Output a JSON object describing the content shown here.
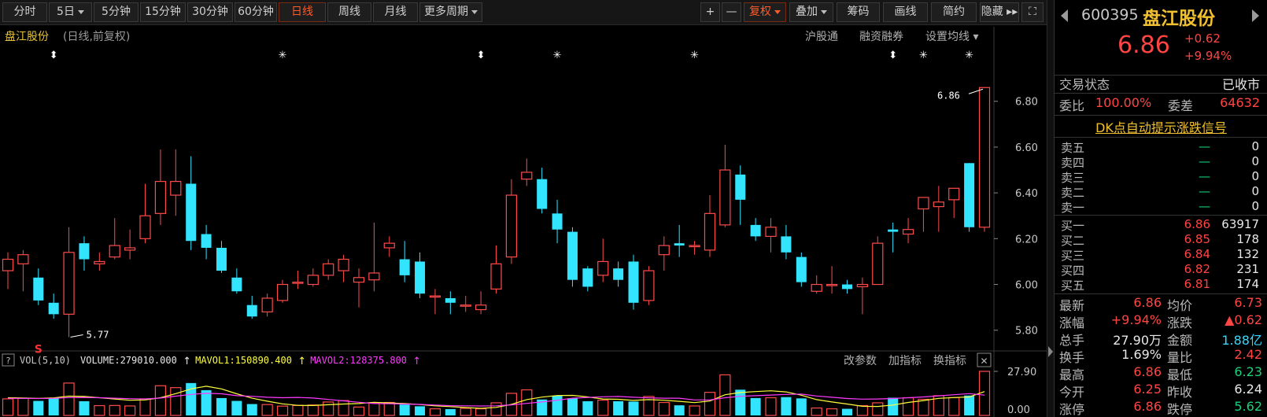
{
  "toolbar": {
    "periods": [
      {
        "label": "分时",
        "dropdown": false,
        "active": false
      },
      {
        "label": "5日",
        "dropdown": true,
        "active": false
      },
      {
        "label": "5分钟",
        "dropdown": false,
        "active": false
      },
      {
        "label": "15分钟",
        "dropdown": false,
        "active": false
      },
      {
        "label": "30分钟",
        "dropdown": false,
        "active": false
      },
      {
        "label": "60分钟",
        "dropdown": false,
        "active": false
      },
      {
        "label": "日线",
        "dropdown": false,
        "active": true
      },
      {
        "label": "周线",
        "dropdown": false,
        "active": false
      },
      {
        "label": "月线",
        "dropdown": false,
        "active": false
      },
      {
        "label": "更多周期",
        "dropdown": true,
        "active": false
      }
    ],
    "right": [
      {
        "label": "+",
        "dropdown": false,
        "active": false
      },
      {
        "label": "—",
        "dropdown": false,
        "active": false
      },
      {
        "label": "复权",
        "dropdown": true,
        "active": true
      },
      {
        "label": "叠加",
        "dropdown": true,
        "active": false
      },
      {
        "label": "筹码",
        "dropdown": false,
        "active": false
      },
      {
        "label": "画线",
        "dropdown": false,
        "active": false
      },
      {
        "label": "简约",
        "dropdown": false,
        "active": false
      },
      {
        "label": "隐藏 ▸▸",
        "dropdown": false,
        "active": false
      },
      {
        "label": "⛶",
        "dropdown": false,
        "active": false
      }
    ]
  },
  "header": {
    "stock_name": "盘江股份",
    "mode": "(日线,前复权)",
    "links": [
      "沪股通",
      "融资融券",
      "设置均线 ▾"
    ]
  },
  "chart_data": [
    {
      "type": "candlestick",
      "y_axis_ticks": [
        6.8,
        6.6,
        6.4,
        6.2,
        6.0,
        5.8
      ],
      "ylim": [
        5.72,
        6.94
      ],
      "annotations": {
        "high_label": "6.86",
        "low_label": "5.77",
        "signal": "S"
      },
      "event_markers": [
        {
          "candle": 3,
          "symbol": "⬍"
        },
        {
          "candle": 18,
          "symbol": "✳"
        },
        {
          "candle": 31,
          "symbol": "⬍"
        },
        {
          "candle": 36,
          "symbol": "✳"
        },
        {
          "candle": 45,
          "symbol": "✳"
        },
        {
          "candle": 58,
          "symbol": "⬍"
        },
        {
          "candle": 60,
          "symbol": "✳"
        },
        {
          "candle": 63,
          "symbol": "✳"
        }
      ],
      "candles": [
        {
          "o": 6.06,
          "c": 6.11,
          "h": 6.14,
          "l": 5.98
        },
        {
          "o": 6.09,
          "c": 6.13,
          "h": 6.15,
          "l": 5.97
        },
        {
          "o": 6.03,
          "c": 5.93,
          "h": 6.07,
          "l": 5.91
        },
        {
          "o": 5.92,
          "c": 5.87,
          "h": 5.96,
          "l": 5.85
        },
        {
          "o": 5.87,
          "c": 6.14,
          "h": 6.25,
          "l": 5.77
        },
        {
          "o": 6.18,
          "c": 6.11,
          "h": 6.21,
          "l": 6.06
        },
        {
          "o": 6.09,
          "c": 6.1,
          "h": 6.14,
          "l": 6.06
        },
        {
          "o": 6.12,
          "c": 6.17,
          "h": 6.29,
          "l": 6.11
        },
        {
          "o": 6.15,
          "c": 6.16,
          "h": 6.24,
          "l": 6.11
        },
        {
          "o": 6.2,
          "c": 6.3,
          "h": 6.44,
          "l": 6.18
        },
        {
          "o": 6.31,
          "c": 6.45,
          "h": 6.59,
          "l": 6.26
        },
        {
          "o": 6.39,
          "c": 6.45,
          "h": 6.59,
          "l": 6.3
        },
        {
          "o": 6.44,
          "c": 6.19,
          "h": 6.56,
          "l": 6.15
        },
        {
          "o": 6.22,
          "c": 6.16,
          "h": 6.26,
          "l": 6.11
        },
        {
          "o": 6.16,
          "c": 6.06,
          "h": 6.19,
          "l": 6.05
        },
        {
          "o": 6.03,
          "c": 5.97,
          "h": 6.07,
          "l": 5.96
        },
        {
          "o": 5.91,
          "c": 5.86,
          "h": 5.95,
          "l": 5.85
        },
        {
          "o": 5.88,
          "c": 5.94,
          "h": 5.96,
          "l": 5.86
        },
        {
          "o": 5.93,
          "c": 6.0,
          "h": 6.02,
          "l": 5.92
        },
        {
          "o": 6.01,
          "c": 6.01,
          "h": 6.06,
          "l": 5.98
        },
        {
          "o": 6.0,
          "c": 6.04,
          "h": 6.07,
          "l": 5.99
        },
        {
          "o": 6.04,
          "c": 6.09,
          "h": 6.11,
          "l": 6.02
        },
        {
          "o": 6.06,
          "c": 6.11,
          "h": 6.13,
          "l": 6.01
        },
        {
          "o": 6.01,
          "c": 6.03,
          "h": 6.07,
          "l": 5.9
        },
        {
          "o": 6.02,
          "c": 6.05,
          "h": 6.27,
          "l": 5.97
        },
        {
          "o": 6.16,
          "c": 6.18,
          "h": 6.21,
          "l": 6.12
        },
        {
          "o": 6.11,
          "c": 6.04,
          "h": 6.19,
          "l": 6.01
        },
        {
          "o": 6.1,
          "c": 5.96,
          "h": 6.14,
          "l": 5.94
        },
        {
          "o": 5.95,
          "c": 5.95,
          "h": 5.98,
          "l": 5.87
        },
        {
          "o": 5.94,
          "c": 5.92,
          "h": 5.97,
          "l": 5.87
        },
        {
          "o": 5.91,
          "c": 5.91,
          "h": 5.95,
          "l": 5.88
        },
        {
          "o": 5.89,
          "c": 5.91,
          "h": 5.97,
          "l": 5.87
        },
        {
          "o": 5.98,
          "c": 6.09,
          "h": 6.17,
          "l": 5.96
        },
        {
          "o": 6.12,
          "c": 6.39,
          "h": 6.46,
          "l": 6.09
        },
        {
          "o": 6.46,
          "c": 6.49,
          "h": 6.55,
          "l": 6.43
        },
        {
          "o": 6.46,
          "c": 6.33,
          "h": 6.51,
          "l": 6.31
        },
        {
          "o": 6.31,
          "c": 6.24,
          "h": 6.37,
          "l": 6.18
        },
        {
          "o": 6.23,
          "c": 6.02,
          "h": 6.25,
          "l": 5.99
        },
        {
          "o": 6.07,
          "c": 5.99,
          "h": 6.08,
          "l": 5.97
        },
        {
          "o": 6.04,
          "c": 6.1,
          "h": 6.2,
          "l": 6.01
        },
        {
          "o": 6.07,
          "c": 6.02,
          "h": 6.1,
          "l": 5.99
        },
        {
          "o": 6.1,
          "c": 5.92,
          "h": 6.13,
          "l": 5.89
        },
        {
          "o": 5.93,
          "c": 6.06,
          "h": 6.08,
          "l": 5.91
        },
        {
          "o": 6.13,
          "c": 6.17,
          "h": 6.21,
          "l": 6.06
        },
        {
          "o": 6.18,
          "c": 6.17,
          "h": 6.26,
          "l": 6.12
        },
        {
          "o": 6.17,
          "c": 6.17,
          "h": 6.19,
          "l": 6.13
        },
        {
          "o": 6.15,
          "c": 6.31,
          "h": 6.39,
          "l": 6.12
        },
        {
          "o": 6.26,
          "c": 6.5,
          "h": 6.61,
          "l": 6.25
        },
        {
          "o": 6.48,
          "c": 6.37,
          "h": 6.52,
          "l": 6.26
        },
        {
          "o": 6.26,
          "c": 6.21,
          "h": 6.29,
          "l": 6.19
        },
        {
          "o": 6.21,
          "c": 6.25,
          "h": 6.29,
          "l": 6.14
        },
        {
          "o": 6.21,
          "c": 6.14,
          "h": 6.26,
          "l": 6.11
        },
        {
          "o": 6.12,
          "c": 6.01,
          "h": 6.14,
          "l": 5.99
        },
        {
          "o": 5.97,
          "c": 6.0,
          "h": 6.04,
          "l": 5.96
        },
        {
          "o": 6.0,
          "c": 6.0,
          "h": 6.08,
          "l": 5.96
        },
        {
          "o": 6.0,
          "c": 5.98,
          "h": 6.02,
          "l": 5.96
        },
        {
          "o": 5.99,
          "c": 6.0,
          "h": 6.03,
          "l": 5.87
        },
        {
          "o": 6.0,
          "c": 6.18,
          "h": 6.21,
          "l": 6.0
        },
        {
          "o": 6.24,
          "c": 6.23,
          "h": 6.27,
          "l": 6.14
        },
        {
          "o": 6.22,
          "c": 6.24,
          "h": 6.29,
          "l": 6.18
        },
        {
          "o": 6.33,
          "c": 6.38,
          "h": 6.38,
          "l": 6.23
        },
        {
          "o": 6.34,
          "c": 6.36,
          "h": 6.43,
          "l": 6.23
        },
        {
          "o": 6.37,
          "c": 6.42,
          "h": 6.42,
          "l": 6.29
        },
        {
          "o": 6.53,
          "c": 6.25,
          "h": 6.53,
          "l": 6.23
        },
        {
          "o": 6.25,
          "c": 6.86,
          "h": 6.86,
          "l": 6.23
        }
      ]
    },
    {
      "type": "bar",
      "title": "VOL(5,10)",
      "legend": [
        {
          "label": "VOLUME:279010.000",
          "color": "#e8e8e8"
        },
        {
          "label": "MAVOL1:150890.400",
          "color": "#ffff3a"
        },
        {
          "label": "MAVOL2:128375.800",
          "color": "#ff3aff"
        }
      ],
      "y_axis_ticks": [
        "27.90",
        "0.00"
      ],
      "ylim": [
        0,
        279010
      ],
      "volumes": [
        105000,
        108000,
        92000,
        108000,
        205000,
        90000,
        62000,
        63000,
        60000,
        105000,
        188000,
        176000,
        205000,
        160000,
        110000,
        92000,
        72000,
        69000,
        59000,
        63000,
        66000,
        85000,
        94000,
        53000,
        80000,
        82000,
        69000,
        58000,
        42000,
        40000,
        45000,
        42000,
        80000,
        140000,
        162000,
        101000,
        125000,
        108000,
        90000,
        97000,
        90000,
        88000,
        120000,
        82000,
        64000,
        60000,
        146000,
        257000,
        163000,
        110000,
        112000,
        116000,
        108000,
        47000,
        42000,
        42000,
        62000,
        80000,
        112000,
        112000,
        102000,
        125000,
        113000,
        126000,
        279010
      ],
      "mavol1": [
        112000,
        110000,
        108000,
        111000,
        122000,
        120000,
        112000,
        104000,
        96000,
        98000,
        112000,
        138000,
        168000,
        185000,
        168000,
        137000,
        109000,
        90000,
        73000,
        64000,
        63000,
        68000,
        72000,
        75000,
        83000,
        79000,
        75000,
        69000,
        61000,
        56000,
        50000,
        45000,
        51000,
        70000,
        100000,
        116000,
        126000,
        127000,
        117000,
        104000,
        102000,
        95000,
        100000,
        96000,
        89000,
        81000,
        91000,
        131000,
        145000,
        151000,
        156000,
        149000,
        128000,
        100000,
        85000,
        72000,
        58000,
        57000,
        66000,
        82000,
        94000,
        108000,
        113000,
        117000,
        150890
      ],
      "mavol2": [
        108000,
        108000,
        107000,
        108000,
        113000,
        114000,
        112000,
        109000,
        106000,
        104000,
        110000,
        122000,
        133000,
        140000,
        137000,
        125000,
        121000,
        115000,
        112000,
        114000,
        110000,
        101000,
        92000,
        83000,
        75000,
        74000,
        72000,
        70000,
        66000,
        62000,
        61000,
        60000,
        61000,
        67000,
        76000,
        85000,
        96000,
        109000,
        114000,
        118000,
        120000,
        115000,
        111000,
        109000,
        109000,
        98000,
        98000,
        112000,
        121000,
        125000,
        129000,
        133000,
        135000,
        123000,
        115000,
        107000,
        103000,
        104000,
        107000,
        112000,
        117000,
        124000,
        131000,
        138000,
        128376
      ]
    }
  ],
  "vol_header": {
    "help": "?",
    "title": "VOL(5,10)",
    "tools": [
      "改参数",
      "加指标",
      "换指标"
    ],
    "close": "✕"
  },
  "colors": {
    "up": "#ff4a4a",
    "down": "#33e4ff",
    "ma_yellow": "#ffff3a",
    "ma_magenta": "#ff3aff",
    "accent": "#ff5a2a",
    "gold": "#f0c030"
  },
  "quote": {
    "code": "600395",
    "name": "盘江股份",
    "price": "6.86",
    "change": "+0.62",
    "change_pct": "+9.94%",
    "trade_status_label": "交易状态",
    "trade_status": "已收市",
    "weibi_label": "委比",
    "weibi": "100.00%",
    "weicha_label": "委差",
    "weicha": "64632",
    "dk_link": "DK点自动提示涨跌信号",
    "asks": [
      {
        "label": "卖五",
        "price": "—",
        "vol": "0"
      },
      {
        "label": "卖四",
        "price": "—",
        "vol": "0"
      },
      {
        "label": "卖三",
        "price": "—",
        "vol": "0"
      },
      {
        "label": "卖二",
        "price": "—",
        "vol": "0"
      },
      {
        "label": "卖一",
        "price": "—",
        "vol": "0"
      }
    ],
    "bids": [
      {
        "label": "买一",
        "price": "6.86",
        "vol": "63917"
      },
      {
        "label": "买二",
        "price": "6.85",
        "vol": "178"
      },
      {
        "label": "买三",
        "price": "6.84",
        "vol": "132"
      },
      {
        "label": "买四",
        "price": "6.82",
        "vol": "231"
      },
      {
        "label": "买五",
        "price": "6.81",
        "vol": "174"
      }
    ],
    "stats": [
      {
        "l1": "最新",
        "v1": "6.86",
        "c1": "red",
        "l2": "均价",
        "v2": "6.73",
        "c2": "red"
      },
      {
        "l1": "涨幅",
        "v1": "+9.94%",
        "c1": "red",
        "l2": "涨跌",
        "v2": "▲0.62",
        "c2": "red"
      },
      {
        "l1": "总手",
        "v1": "27.90万",
        "c1": "wht",
        "l2": "金额",
        "v2": "1.88亿",
        "c2": "cyan"
      },
      {
        "l1": "换手",
        "v1": "1.69%",
        "c1": "wht",
        "l2": "量比",
        "v2": "2.42",
        "c2": "red"
      },
      {
        "l1": "最高",
        "v1": "6.86",
        "c1": "red",
        "l2": "最低",
        "v2": "6.23",
        "c2": "grn"
      },
      {
        "l1": "今开",
        "v1": "6.25",
        "c1": "red",
        "l2": "昨收",
        "v2": "6.24",
        "c2": "wht"
      },
      {
        "l1": "涨停",
        "v1": "6.86",
        "c1": "red",
        "l2": "跌停",
        "v2": "5.62",
        "c2": "grn"
      }
    ]
  }
}
